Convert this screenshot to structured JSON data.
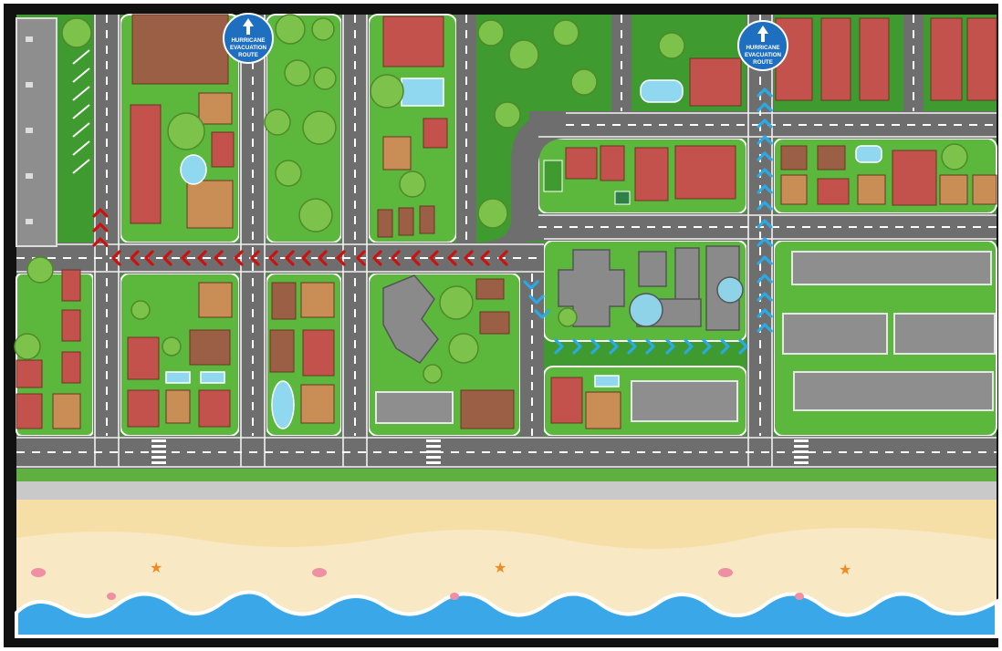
{
  "signs": [
    {
      "line1": "HURRICANE",
      "line2": "EVACUATION",
      "line3": "ROUTE",
      "icon": "up-arrow-icon"
    },
    {
      "line1": "HURRICANE",
      "line2": "EVACUATION",
      "line3": "ROUTE",
      "icon": "up-arrow-icon"
    }
  ],
  "routes": [
    {
      "name": "",
      "color": "#cc1111",
      "direction": "westbound-then-north"
    },
    {
      "name": "",
      "color": "#29a9e6",
      "direction": "eastbound-then-north"
    }
  ],
  "colors": {
    "frame": "#111111",
    "grass": "#3f9a2f",
    "block": "#5cb83c",
    "road": "#6e6e6e",
    "road_edge": "#f2f2f2",
    "sidewalk": "#c9c9c9",
    "sand": "#f5dfa6",
    "water": "#3aa8e8",
    "roof_red": "#c2524b",
    "roof_brown": "#9b5f45",
    "roof_tan": "#c98d56",
    "building_grey": "#8e8e8e",
    "sign_blue": "#1f6fc0"
  }
}
